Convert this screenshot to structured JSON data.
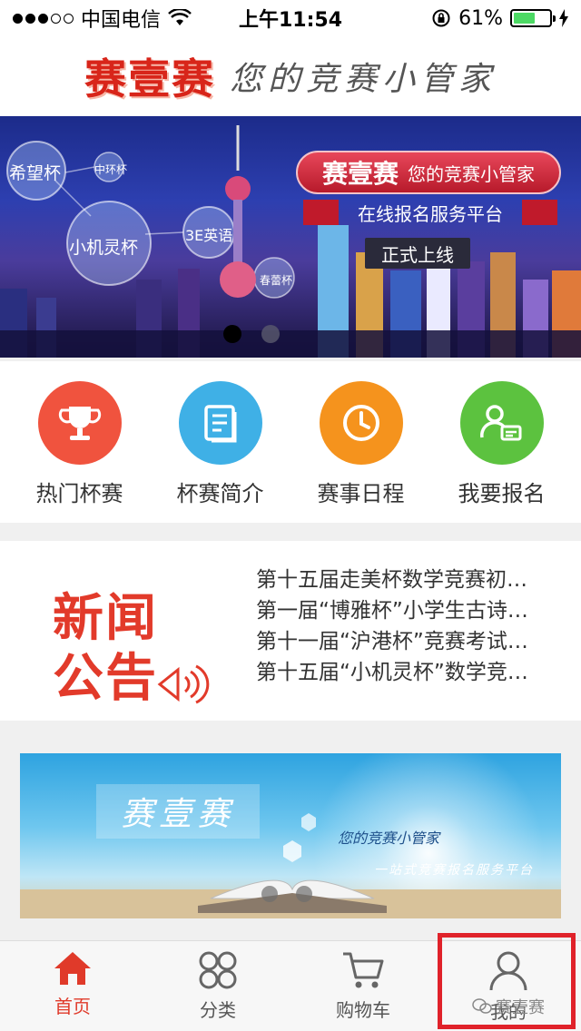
{
  "status_bar": {
    "carrier": "中国电信",
    "time": "上午11:54",
    "battery_percent": "61%",
    "battery_level": 0.61,
    "signal_bars_filled": 3
  },
  "header": {
    "logo": "赛壹赛",
    "slogan": "您的竞赛小管家"
  },
  "banner": {
    "title": "赛壹赛",
    "title_sub": "您的竞赛小管家",
    "subtitle": "在线报名服务平台",
    "launch": "正式上线",
    "bubbles": [
      "希望杯",
      "中环杯",
      "小机灵杯",
      "3E英语",
      "春蕾杯"
    ],
    "page_count": 2,
    "active_page": 1
  },
  "categories": [
    {
      "label": "热门杯赛",
      "icon": "trophy-icon",
      "color": "#f0533e"
    },
    {
      "label": "杯赛简介",
      "icon": "document-icon",
      "color": "#3fb0e6"
    },
    {
      "label": "赛事日程",
      "icon": "clock-icon",
      "color": "#f5931d"
    },
    {
      "label": "我要报名",
      "icon": "user-form-icon",
      "color": "#5cc23f"
    }
  ],
  "news": {
    "logo_line1": "新闻",
    "logo_line2": "公告",
    "items": [
      "第十五届走美杯数学竞赛初…",
      "第一届“博雅杯”小学生古诗…",
      "第十一届“沪港杯”竞赛考试…",
      "第十五届“小机灵杯”数学竞…"
    ]
  },
  "promo": {
    "title": "赛壹赛",
    "line1": "您的竞赛小管家",
    "line2": "一站式竞赛报名服务平台"
  },
  "tabbar": {
    "tabs": [
      {
        "label": "首页",
        "icon": "home-icon",
        "active": true
      },
      {
        "label": "分类",
        "icon": "category-icon",
        "active": false
      },
      {
        "label": "购物车",
        "icon": "cart-icon",
        "active": false
      },
      {
        "label": "我的",
        "icon": "person-icon",
        "active": false
      }
    ]
  },
  "watermark": "赛壹赛",
  "colors": {
    "brand_red": "#d8251a",
    "active_tab": "#e03a2a",
    "highlight_border": "#e0222a"
  }
}
